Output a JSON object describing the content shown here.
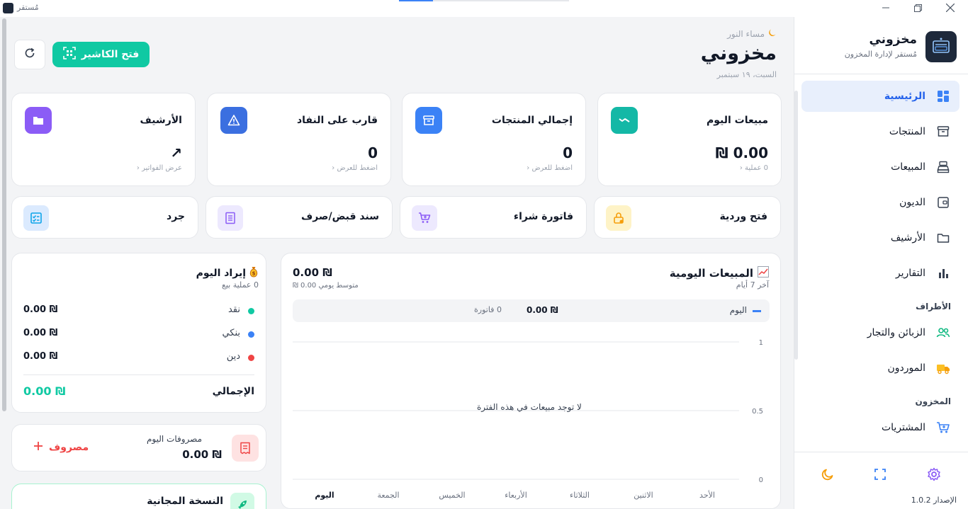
{
  "window": {
    "title": "مُستقر",
    "controls": [
      "minimize-icon",
      "restore-icon",
      "close-icon"
    ]
  },
  "sidebar": {
    "brand_name": "مخزوني",
    "brand_subtitle": "مُستقر لإدارة المخزون",
    "items": [
      {
        "label": "الرئيسية",
        "icon": "dashboard-icon",
        "active": true
      },
      {
        "label": "المنتجات",
        "icon": "archive-box-icon"
      },
      {
        "label": "المبيعات",
        "icon": "cash-register-icon"
      },
      {
        "label": "الديون",
        "icon": "wallet-icon"
      },
      {
        "label": "الأرشيف",
        "icon": "folder-icon"
      },
      {
        "label": "التقارير",
        "icon": "bar-chart-icon"
      }
    ],
    "section_parties": "الأطراف",
    "parties_items": [
      {
        "label": "الزبائن والتجار",
        "icon": "users-icon"
      },
      {
        "label": "الموردون",
        "icon": "truck-icon"
      }
    ],
    "section_inventory": "المخزون",
    "inventory_items": [
      {
        "label": "المشتريات",
        "icon": "cart-icon"
      }
    ],
    "version": "الإصدار 1.0.2"
  },
  "header": {
    "greeting": "مساء النور",
    "title": "مخزوني",
    "date": "السبت، ١٩ سبتمبر",
    "cashier_button": "فتح الكاشير"
  },
  "stats": [
    {
      "title": "مبيعات اليوم",
      "value": "0.00 ₪",
      "hint": "0 عملية",
      "icon": "trend-icon",
      "color": "#14b8a6"
    },
    {
      "title": "إجمالي المنتجات",
      "value": "0",
      "hint": "اضغط للعرض",
      "icon": "archive-box-icon",
      "color": "#3b82f6"
    },
    {
      "title": "قارب على النفاد",
      "value": "0",
      "hint": "اضغط للعرض",
      "icon": "warning-icon",
      "color": "#3b6fe0"
    },
    {
      "title": "الأرشيف",
      "value": "↗",
      "hint": "عرض الفواتير",
      "icon": "folder-icon",
      "color": "#8b5cf6"
    }
  ],
  "actions": [
    {
      "label": "فتح وردية",
      "icon": "lock-icon",
      "bg": "#fef3c7",
      "color": "#f59e0b"
    },
    {
      "label": "فاتورة شراء",
      "icon": "cart-plus-icon",
      "bg": "#ede9fe",
      "color": "#8b5cf6"
    },
    {
      "label": "سند قبض/صرف",
      "icon": "document-icon",
      "bg": "#ede9fe",
      "color": "#8b5cf6"
    },
    {
      "label": "جرد",
      "icon": "checklist-icon",
      "bg": "#dbeafe",
      "color": "#0ea5e9"
    }
  ],
  "chart_card": {
    "title": "المبيعات اليومية",
    "subtitle": "آخر 7 أيام",
    "total": "0.00 ₪",
    "average": "متوسط يومي 0.00 ₪",
    "legend_name": "اليوم",
    "legend_value": "0.00 ₪",
    "legend_count": "0 فاتورة",
    "empty_message": "لا توجد مبيعات في هذه الفترة"
  },
  "chart_data": {
    "type": "bar",
    "categories": [
      "الأحد",
      "الاثنين",
      "الثلاثاء",
      "الأربعاء",
      "الخميس",
      "الجمعة",
      "اليوم"
    ],
    "values": [
      0,
      0,
      0,
      0,
      0,
      0,
      0
    ],
    "y_ticks": [
      "1",
      "0.5",
      "0"
    ],
    "ylim": [
      0,
      1
    ],
    "title": "المبيعات اليومية",
    "subtitle": "آخر 7 أيام",
    "grid": true
  },
  "income": {
    "title": "إيراد اليوم",
    "subtitle": "0 عملية بيع",
    "rows": [
      {
        "label": "نقد",
        "value": "0.00 ₪",
        "color": "#10c9a3"
      },
      {
        "label": "بنكي",
        "value": "0.00 ₪",
        "color": "#3b82f6"
      },
      {
        "label": "دين",
        "value": "0.00 ₪",
        "color": "#ef4444"
      }
    ],
    "total_label": "الإجمالي",
    "total_value": "0.00 ₪"
  },
  "expenses": {
    "label": "مصروفات اليوم",
    "value": "0.00 ₪",
    "add_label": "مصروف"
  },
  "free_version": {
    "label": "النسخة المجانية"
  }
}
